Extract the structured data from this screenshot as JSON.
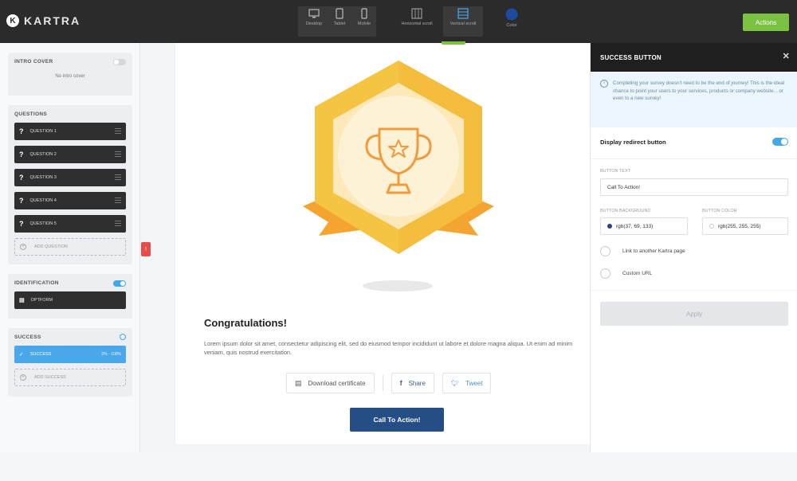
{
  "app": {
    "logo_text": "KARTRA",
    "logo_mark": "K"
  },
  "toolbar": {
    "devices": [
      {
        "icon": "desktop-icon",
        "label": "Desktop"
      },
      {
        "icon": "tablet-icon",
        "label": "Tablet"
      },
      {
        "icon": "mobile-icon",
        "label": "Mobile"
      }
    ],
    "scroll": [
      {
        "icon": "horizontal-scroll-icon",
        "label": "Horizontal scroll"
      },
      {
        "icon": "vertical-scroll-icon",
        "label": "Vertical scroll"
      }
    ],
    "color_label": "Color",
    "color_value": "#1e4aa0",
    "actions_label": "Actions"
  },
  "sidebar": {
    "intro_cover": {
      "title": "INTRO COVER",
      "empty_text": "No intro cover"
    },
    "questions": {
      "title": "QUESTIONS",
      "items": [
        "QUESTION 1",
        "QUESTION 2",
        "QUESTION 3",
        "QUESTION 4",
        "QUESTION 5"
      ],
      "add_label": "ADD QUESTION"
    },
    "identification": {
      "title": "IDENTIFICATION",
      "item": "OPTFORM"
    },
    "success": {
      "title": "SUCCESS",
      "item": "SUCCESS",
      "item_range": "0% - 100%",
      "add_label": "ADD SUCCESS"
    }
  },
  "canvas": {
    "heading": "Congratulations!",
    "body": "Lorem ipsum dolor sit amet, consectetur adipiscing elit, sed do eiusmod tempor incididunt ut labore et dolore magna aliqua. Ut enim ad minim veniam, quis nostrud exercitation.",
    "download_label": "Download certificate",
    "share_label": "Share",
    "tweet_label": "Tweet",
    "cta_label": "Call To Action!"
  },
  "right_panel": {
    "title": "SUCCESS BUTTON",
    "info_text": "Completing your survey doesn't need to be the end of journey! This is the ideal chance to point your users to your services, products or company website... or even to a new survey!",
    "display_redirect_label": "Display redirect button",
    "button_text_label": "BUTTON TEXT",
    "button_text_value": "Call To Action!",
    "bg_label": "BUTTON BACKGROUND",
    "bg_value": "rgb(37, 69, 133)",
    "color_label": "BUTTON COLOR",
    "color_value": "rgb(255, 255, 255)",
    "option_kartra_page": "Link to another Kartra page",
    "option_custom_url": "Custom URL",
    "apply_label": "Apply"
  },
  "colors": {
    "accent_green": "#7cc242",
    "accent_blue": "#44a8e8",
    "cta_blue": "#254d86",
    "alert_red": "#e74c4c"
  }
}
